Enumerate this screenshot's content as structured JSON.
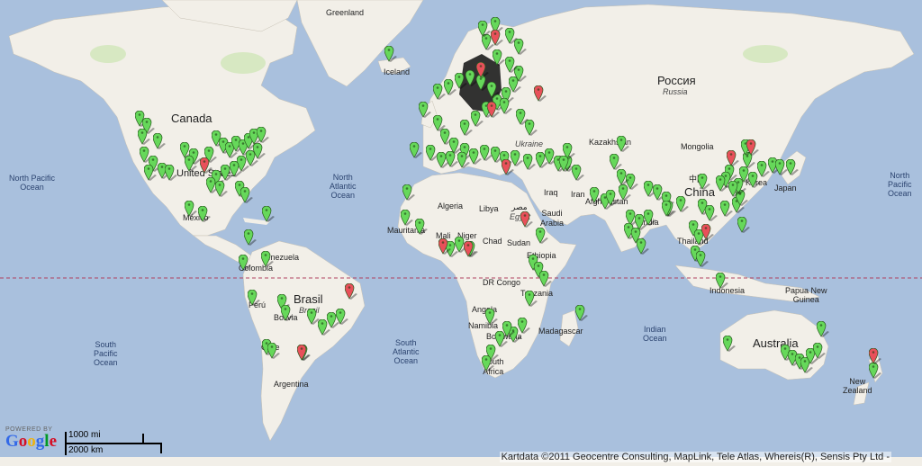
{
  "map": {
    "labels": {
      "greenland": "Greenland",
      "iceland": "Iceland",
      "canada": "Canada",
      "united_states": "United States",
      "rossiya": "Россия",
      "russia": "Russia",
      "kazakhstan": "Kazakhstan",
      "mongolia": "Mongolia",
      "china_han": "中国",
      "china": "China",
      "korea": "Korea",
      "japan": "Japan",
      "ukraine": "Ukraine",
      "iraq": "Iraq",
      "iran": "Iran",
      "afghanistan": "Afghanistan",
      "india": "India",
      "thailand": "Thailand",
      "saudi_arabia": "Saudi\nArabia",
      "algeria": "Algeria",
      "libya": "Libya",
      "egypt_ar": "مصر",
      "egypt": "Egypt",
      "mauritania": "Mauritania",
      "mali": "Mali",
      "niger": "Niger",
      "chad": "Chad",
      "sudan": "Sudan",
      "ethiopia": "Ethiopia",
      "dr_congo": "DR Congo",
      "tanzania": "Tanzania",
      "angola": "Angola",
      "namibia": "Namibia",
      "botswana": "Botswana",
      "south_africa": "South\nAfrica",
      "madagascar": "Madagascar",
      "venezuela": "Venezuela",
      "colombia": "Colombia",
      "peru": "Perú",
      "bolivia": "Bolivia",
      "brasil": "Brasil",
      "brazil": "Brazil",
      "chile": "Chile",
      "argentina": "Argentina",
      "mexico": "México",
      "indonesia": "Indonesia",
      "papua_new_guinea": "Papua New\nGuinea",
      "australia": "Australia",
      "new_zealand": "New\nZealand",
      "north_pacific_ocean": "North Pacific\nOcean",
      "north_pacific_ocean_east": "North\nPacific\nOcean",
      "north_atlantic_ocean": "North\nAtlantic\nOcean",
      "south_pacific_ocean": "South\nPacific\nOcean",
      "south_atlantic_ocean": "South\nAtlantic\nOcean",
      "indian_ocean": "Indian\nOcean"
    },
    "marker_colors": {
      "green": "#66d85a",
      "red": "#e8505a",
      "outline": "#2a5a20",
      "shadow": "rgba(0,0,0,0.35)"
    },
    "land_color": "#f2efe8",
    "water_color": "#a9c0dd",
    "park_color": "#cfe6b8"
  },
  "branding": {
    "powered_by": "POWERED BY",
    "google": "Google"
  },
  "scale": {
    "top_label": "1000 mi",
    "bottom_label": "2000 km"
  },
  "attribution": "Kartdata ©2011 Geocentre Consulting, MapLink, Tele Atlas, Whereis(R), Sensis Pty Ltd -"
}
